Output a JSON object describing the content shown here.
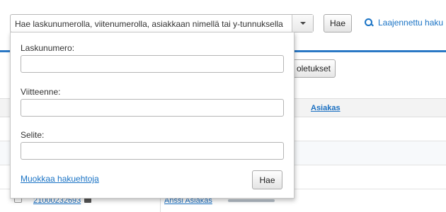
{
  "search": {
    "text": "Hae laskunumerolla, viitenumerolla, asiakkaan nimellä tai y-tunnuksella",
    "button_label": "Hae",
    "advanced_link": "Laajennettu haku"
  },
  "background": {
    "partial_button_label": "oletukset",
    "column_asiakas": "Asiakas",
    "row": {
      "invoice_number": "21000232693",
      "customer_name": "Anssi Asiakas"
    }
  },
  "panel": {
    "fields": [
      {
        "label": "Laskunumero:",
        "value": ""
      },
      {
        "label": "Viitteenne:",
        "value": ""
      },
      {
        "label": "Selite:",
        "value": ""
      }
    ],
    "edit_link": "Muokkaa hakuehtoja",
    "search_button": "Hae"
  },
  "colors": {
    "link": "#1a73c5",
    "accent_bar": "#2a78c5"
  }
}
